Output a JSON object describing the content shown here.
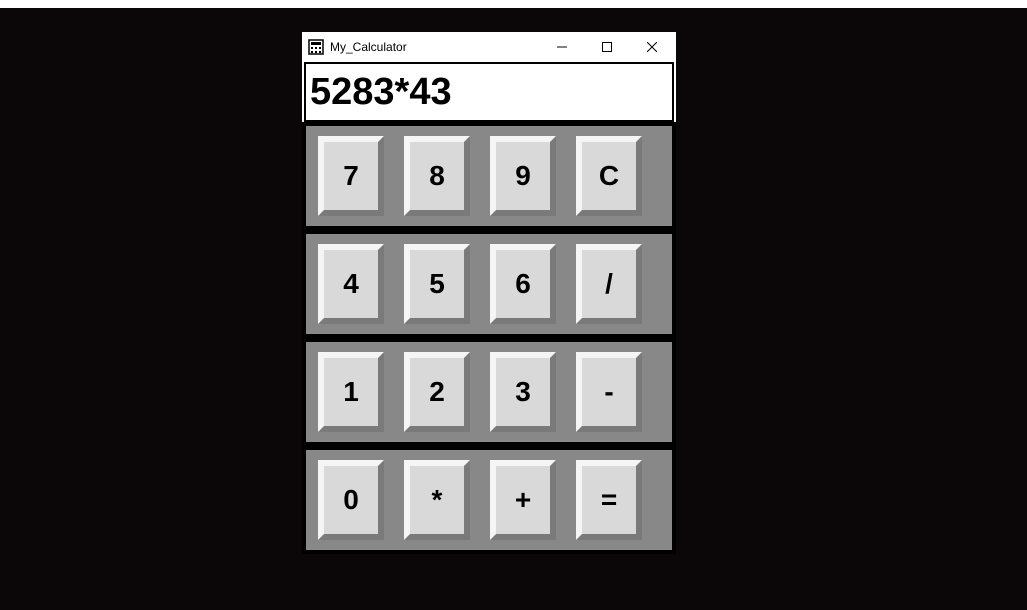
{
  "window": {
    "title": "My_Calculator",
    "icon": "calculator-icon"
  },
  "display": {
    "value": "5283*43"
  },
  "rows": [
    {
      "buttons": [
        {
          "label": "7",
          "name": "button-7"
        },
        {
          "label": "8",
          "name": "button-8"
        },
        {
          "label": "9",
          "name": "button-9"
        },
        {
          "label": "C",
          "name": "button-clear"
        }
      ]
    },
    {
      "buttons": [
        {
          "label": "4",
          "name": "button-4"
        },
        {
          "label": "5",
          "name": "button-5"
        },
        {
          "label": "6",
          "name": "button-6"
        },
        {
          "label": "/",
          "name": "button-divide"
        }
      ]
    },
    {
      "buttons": [
        {
          "label": "1",
          "name": "button-1"
        },
        {
          "label": "2",
          "name": "button-2"
        },
        {
          "label": "3",
          "name": "button-3"
        },
        {
          "label": "-",
          "name": "button-subtract"
        }
      ]
    },
    {
      "buttons": [
        {
          "label": "0",
          "name": "button-0"
        },
        {
          "label": "*",
          "name": "button-multiply"
        },
        {
          "label": "+",
          "name": "button-add"
        },
        {
          "label": "=",
          "name": "button-equals"
        }
      ]
    }
  ]
}
